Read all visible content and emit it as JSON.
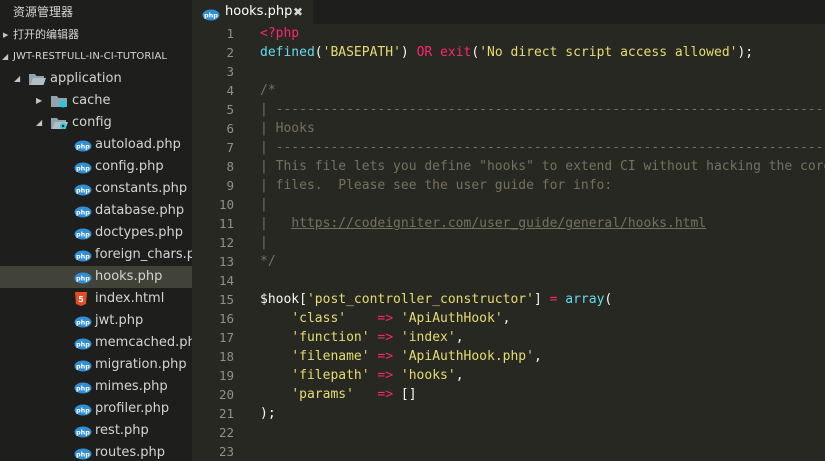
{
  "explorer": {
    "title": "资源管理器",
    "open_editors_label": "打开的编辑器",
    "project_label": "JWT-RESTFULL-IN-CI-TUTORIAL",
    "tree": [
      {
        "label": "application",
        "depth": 0,
        "type": "folder-open",
        "expanded": true
      },
      {
        "label": "cache",
        "depth": 1,
        "type": "folder-cache",
        "expanded": false
      },
      {
        "label": "config",
        "depth": 1,
        "type": "folder-config",
        "expanded": true
      },
      {
        "label": "autoload.php",
        "depth": 2,
        "type": "php"
      },
      {
        "label": "config.php",
        "depth": 2,
        "type": "php"
      },
      {
        "label": "constants.php",
        "depth": 2,
        "type": "php"
      },
      {
        "label": "database.php",
        "depth": 2,
        "type": "php"
      },
      {
        "label": "doctypes.php",
        "depth": 2,
        "type": "php"
      },
      {
        "label": "foreign_chars.php",
        "depth": 2,
        "type": "php"
      },
      {
        "label": "hooks.php",
        "depth": 2,
        "type": "php",
        "active": true
      },
      {
        "label": "index.html",
        "depth": 2,
        "type": "html"
      },
      {
        "label": "jwt.php",
        "depth": 2,
        "type": "php"
      },
      {
        "label": "memcached.php",
        "depth": 2,
        "type": "php"
      },
      {
        "label": "migration.php",
        "depth": 2,
        "type": "php"
      },
      {
        "label": "mimes.php",
        "depth": 2,
        "type": "php"
      },
      {
        "label": "profiler.php",
        "depth": 2,
        "type": "php"
      },
      {
        "label": "rest.php",
        "depth": 2,
        "type": "php"
      },
      {
        "label": "routes.php",
        "depth": 2,
        "type": "php"
      }
    ]
  },
  "tab": {
    "label": "hooks.php",
    "close_glyph": "✖",
    "icon": "php-file-icon"
  },
  "editor": {
    "lines": [
      {
        "n": "1",
        "tokens": [
          [
            "t-kw",
            "<?php"
          ]
        ]
      },
      {
        "n": "2",
        "tokens": [
          [
            "t-fn",
            "defined"
          ],
          [
            "t-plain",
            "("
          ],
          [
            "t-str",
            "'BASEPATH'"
          ],
          [
            "t-plain",
            ") "
          ],
          [
            "t-kw",
            "OR"
          ],
          [
            "t-plain",
            " "
          ],
          [
            "t-kw",
            "exit"
          ],
          [
            "t-plain",
            "("
          ],
          [
            "t-str",
            "'No direct script access allowed'"
          ],
          [
            "t-plain",
            ");"
          ]
        ]
      },
      {
        "n": "3",
        "tokens": []
      },
      {
        "n": "4",
        "tokens": [
          [
            "t-cm",
            "/*"
          ]
        ]
      },
      {
        "n": "5",
        "tokens": [
          [
            "t-cm",
            "| -------------------------------------------------------------------------"
          ]
        ]
      },
      {
        "n": "6",
        "tokens": [
          [
            "t-cm",
            "| Hooks"
          ]
        ]
      },
      {
        "n": "7",
        "tokens": [
          [
            "t-cm",
            "| -------------------------------------------------------------------------"
          ]
        ]
      },
      {
        "n": "8",
        "tokens": [
          [
            "t-cm",
            "| This file lets you define \"hooks\" to extend CI without hacking the core"
          ]
        ]
      },
      {
        "n": "9",
        "tokens": [
          [
            "t-cm",
            "| files.  Please see the user guide for info:"
          ]
        ]
      },
      {
        "n": "10",
        "tokens": [
          [
            "t-cm",
            "|"
          ]
        ]
      },
      {
        "n": "11",
        "tokens": [
          [
            "t-cm",
            "|   "
          ],
          [
            "t-url",
            "https://codeigniter.com/user_guide/general/hooks.html"
          ]
        ]
      },
      {
        "n": "12",
        "tokens": [
          [
            "t-cm",
            "|"
          ]
        ]
      },
      {
        "n": "13",
        "tokens": [
          [
            "t-cm",
            "*/"
          ]
        ]
      },
      {
        "n": "14",
        "tokens": []
      },
      {
        "n": "15",
        "tokens": [
          [
            "t-var",
            "$hook"
          ],
          [
            "t-plain",
            "["
          ],
          [
            "t-str",
            "'post_controller_constructor'"
          ],
          [
            "t-plain",
            "] "
          ],
          [
            "t-kw",
            "="
          ],
          [
            "t-plain",
            " "
          ],
          [
            "t-fn",
            "array"
          ],
          [
            "t-plain",
            "("
          ]
        ]
      },
      {
        "n": "16",
        "tokens": [
          [
            "t-plain",
            "    "
          ],
          [
            "t-str",
            "'class'"
          ],
          [
            "t-plain",
            "    "
          ],
          [
            "t-kw",
            "=>"
          ],
          [
            "t-plain",
            " "
          ],
          [
            "t-str",
            "'ApiAuthHook'"
          ],
          [
            "t-plain",
            ","
          ]
        ]
      },
      {
        "n": "17",
        "tokens": [
          [
            "t-plain",
            "    "
          ],
          [
            "t-str",
            "'function'"
          ],
          [
            "t-plain",
            " "
          ],
          [
            "t-kw",
            "=>"
          ],
          [
            "t-plain",
            " "
          ],
          [
            "t-str",
            "'index'"
          ],
          [
            "t-plain",
            ","
          ]
        ]
      },
      {
        "n": "18",
        "tokens": [
          [
            "t-plain",
            "    "
          ],
          [
            "t-str",
            "'filename'"
          ],
          [
            "t-plain",
            " "
          ],
          [
            "t-kw",
            "=>"
          ],
          [
            "t-plain",
            " "
          ],
          [
            "t-str",
            "'ApiAuthHook.php'"
          ],
          [
            "t-plain",
            ","
          ]
        ]
      },
      {
        "n": "19",
        "tokens": [
          [
            "t-plain",
            "    "
          ],
          [
            "t-str",
            "'filepath'"
          ],
          [
            "t-plain",
            " "
          ],
          [
            "t-kw",
            "=>"
          ],
          [
            "t-plain",
            " "
          ],
          [
            "t-str",
            "'hooks'"
          ],
          [
            "t-plain",
            ","
          ]
        ]
      },
      {
        "n": "20",
        "tokens": [
          [
            "t-plain",
            "    "
          ],
          [
            "t-str",
            "'params'"
          ],
          [
            "t-plain",
            "   "
          ],
          [
            "t-kw",
            "=>"
          ],
          [
            "t-plain",
            " []"
          ]
        ]
      },
      {
        "n": "21",
        "tokens": [
          [
            "t-plain",
            ");"
          ]
        ]
      },
      {
        "n": "22",
        "tokens": []
      },
      {
        "n": "23",
        "tokens": []
      }
    ]
  },
  "colors": {
    "sidebar_bg": "#1e1f1c",
    "editor_bg": "#272822",
    "active_item_bg": "#414339",
    "keyword": "#f92672",
    "function": "#66d9ef",
    "string": "#e6db74",
    "comment": "#75715e",
    "php_icon": "#2f8ed6",
    "html_icon": "#e44d26"
  }
}
